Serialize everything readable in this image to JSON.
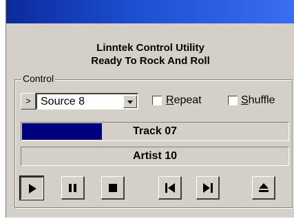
{
  "window": {
    "title": ""
  },
  "header": {
    "line1": "Linntek Control Utility",
    "line2": "Ready To Rock And Roll"
  },
  "control": {
    "group_label": "Control",
    "expand_button_label": ">",
    "source": {
      "selected": "Source 8"
    },
    "repeat": {
      "label_accel": "R",
      "label_rest": "epeat",
      "checked": false
    },
    "shuffle": {
      "label_accel": "S",
      "label_rest": "huffle",
      "checked": false
    },
    "track": {
      "label": "Track 07",
      "progress": 0.3
    },
    "artist": {
      "label": "Artist 10"
    }
  },
  "transport": {
    "buttons": [
      {
        "icon": "play-icon",
        "pressed": true
      },
      {
        "icon": "pause-icon",
        "pressed": false
      },
      {
        "icon": "stop-icon",
        "pressed": false
      },
      {
        "icon": "previous-track-icon",
        "pressed": false
      },
      {
        "icon": "next-track-icon",
        "pressed": false
      },
      {
        "icon": "eject-icon",
        "pressed": false
      }
    ]
  },
  "colors": {
    "title_bar": "#1c4fd1",
    "progress_fill": "#00007f",
    "face": "#d4d0c8"
  }
}
